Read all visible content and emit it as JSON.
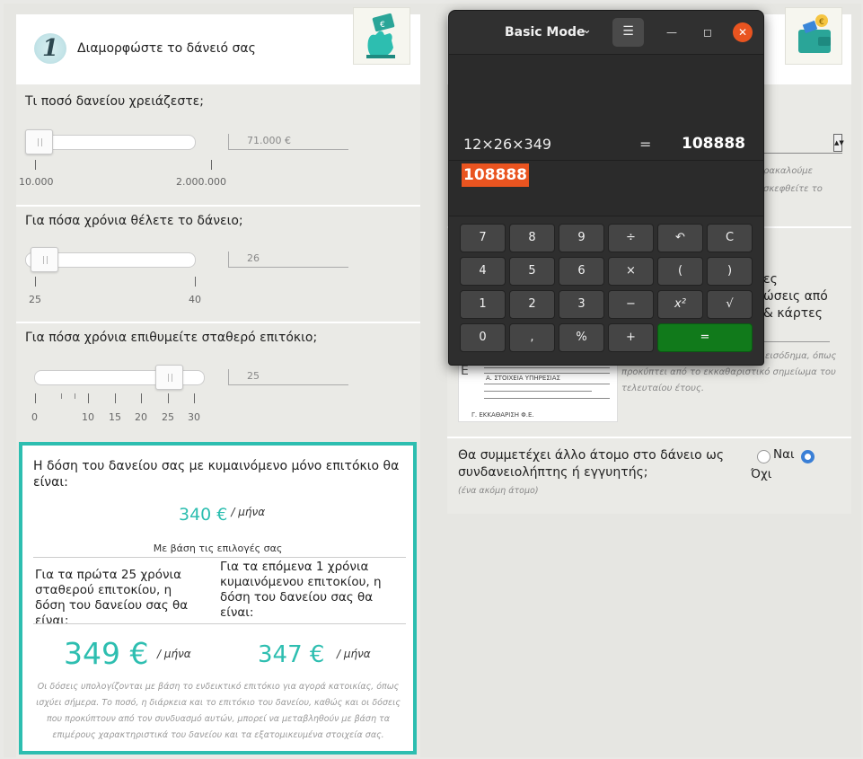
{
  "left": {
    "step_number": "1",
    "step_title": "Διαμορφώστε το δάνειό σας",
    "q1": {
      "label": "Τι ποσό δανείου χρειάζεστε;",
      "value": "71.000 €",
      "min_label": "10.000",
      "max_label": "2.000.000"
    },
    "q2": {
      "label": "Για πόσα χρόνια θέλετε το δάνειο;",
      "value": "26",
      "min_label": "25",
      "max_label": "40"
    },
    "q3": {
      "label": "Για πόσα χρόνια επιθυμείτε σταθερό επιτόκιο;",
      "value": "25",
      "tick_labels": [
        "0",
        "10",
        "15",
        "20",
        "25",
        "30"
      ]
    },
    "result": {
      "title": "Η δόση του δανείου σας με κυμαινόμενο μόνο επιτόκιο θα είναι:",
      "amount": "340 €",
      "unit": "/ μήνα",
      "basis": "Με βάση τις επιλογές σας",
      "col1_text": "Για τα πρώτα 25 χρόνια σταθερού επιτοκίου, η δόση του δανείου σας θα είναι:",
      "col2_text": "Για τα επόμενα 1 χρόνια κυμαινόμενου επιτοκίου, η δόση του δανείου σας θα είναι:",
      "col1_amount": "349 €",
      "col2_amount": "347 €",
      "col_unit": "/ μήνα",
      "note": "Οι δόσεις υπολογίζονται με βάση το ενδεικτικό επιτόκιο για αγορά κατοικίας, όπως ισχύει σήμερα. Το ποσό, η διάρκεια και το επιτόκιο του δανείου, καθώς και οι δόσεις που προκύπτουν από τον συνδυασμό αυτών, μπορεί να μεταβληθούν με βάση τα επιμέρους χαρακτηριστικά του δανείου και τα εξατομικευμένα στοιχεία σας."
    }
  },
  "right": {
    "hint_1a": "ρακαλούμε",
    "hint_1b": "σκεφθείτε το",
    "text_2a": "ες",
    "text_2b": "ώσεις από",
    "text_2c": "& κάρτες",
    "hint_3a": "εισόδημα, όπως",
    "hint_3b": "προκύπτει από το εκκαθαριστικό σημείωμα του",
    "hint_3c": "τελευταίου έτους.",
    "doc_label_1": "Α. ΣΤΟΙΧΕΙΑ ΥΠΗΡΕΣΙΑΣ",
    "doc_label_2": "Γ. ΕΚΚΑΘΑΡΙΣΗ Φ.Ε.",
    "guarantor_question": "Θα συμμετέχει άλλο άτομο στο δάνειο ως συνδανειολήπτης ή εγγυητής;",
    "guarantor_hint": "(ένα ακόμη άτομο)",
    "yes_label": "Ναι",
    "no_label": "Όχι",
    "selected_option": "Όχι"
  },
  "calculator": {
    "mode": "Basic Mode",
    "expression": "12×26×349",
    "equals": "=",
    "result": "108888",
    "entry": "108888",
    "keys": [
      [
        "7",
        "8",
        "9",
        "÷",
        "↶",
        "C"
      ],
      [
        "4",
        "5",
        "6",
        "×",
        "(",
        ")"
      ],
      [
        "1",
        "2",
        "3",
        "−",
        "x²",
        "√"
      ],
      [
        "0",
        ",",
        "%",
        "+",
        "="
      ]
    ]
  }
}
